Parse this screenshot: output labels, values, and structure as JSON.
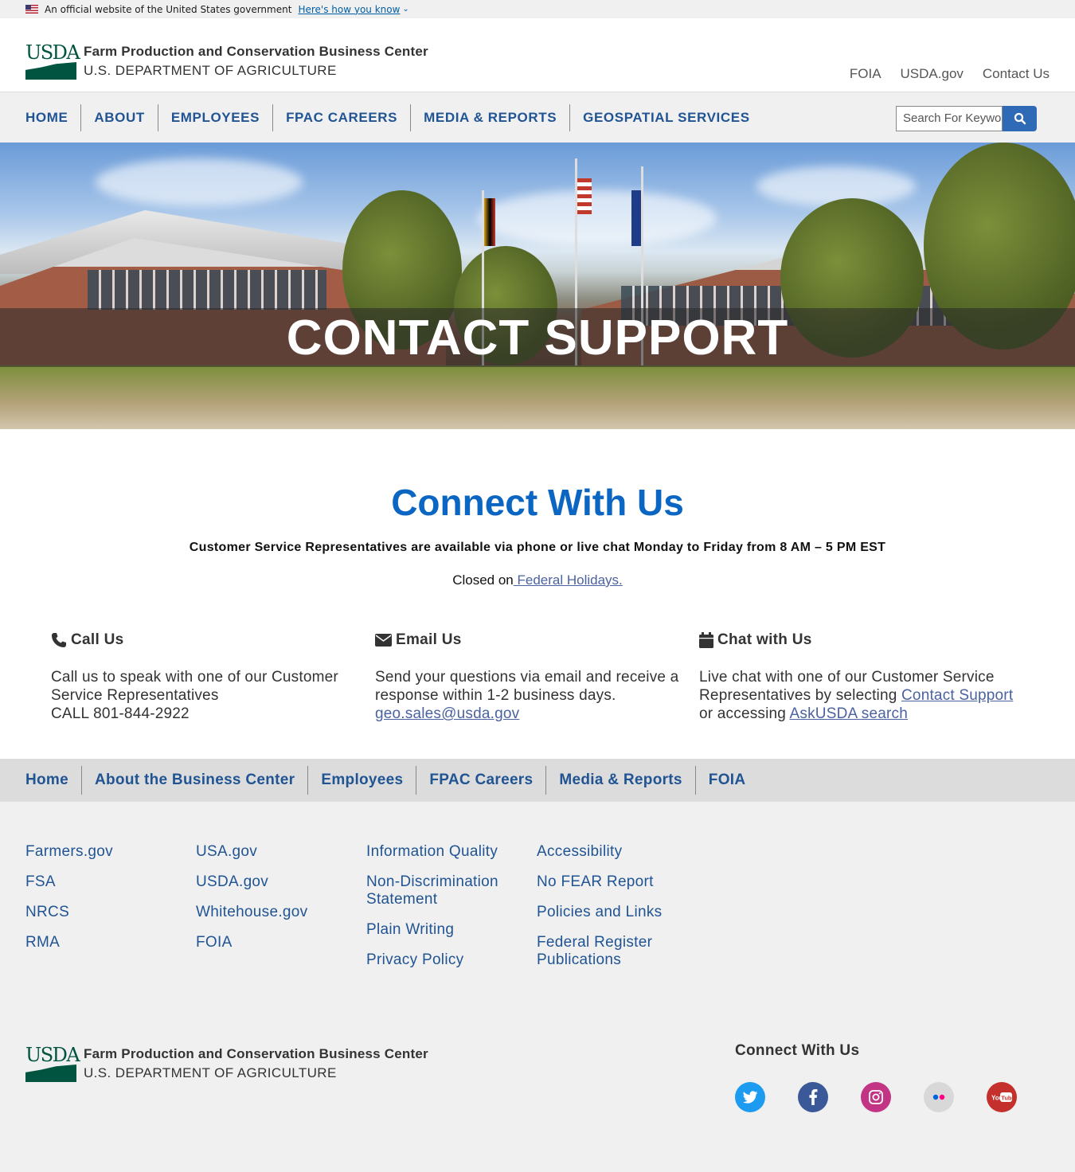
{
  "gov_banner": {
    "text": "An official website of the United States government",
    "link": "Here's how you know"
  },
  "header": {
    "logo_text": "USDA",
    "org_name": "Farm Production and Conservation Business Center",
    "dept_name": "U.S. DEPARTMENT OF AGRICULTURE",
    "utility_links": [
      "FOIA",
      "USDA.gov",
      "Contact Us"
    ]
  },
  "main_nav": {
    "items": [
      "HOME",
      "ABOUT",
      "EMPLOYEES",
      "FPAC CAREERS",
      "MEDIA & REPORTS",
      "GEOSPATIAL SERVICES"
    ],
    "search_placeholder": "Search For Keywords"
  },
  "hero": {
    "title": "CONTACT SUPPORT"
  },
  "connect": {
    "heading": "Connect With Us",
    "hours": "Customer Service Representatives are available via phone or live chat Monday to Friday from 8 AM – 5 PM EST",
    "closed_prefix": "Closed on",
    "closed_link": " Federal Holidays."
  },
  "contact_methods": {
    "call": {
      "title": "Call Us",
      "text": "Call us to speak with one of our Customer Service Representatives",
      "phone": "CALL 801-844-2922"
    },
    "email": {
      "title": "Email Us",
      "text": "Send your questions via email and receive a response within 1-2 business days.",
      "address": "geo.sales@usda.gov"
    },
    "chat": {
      "title": "Chat with Us",
      "text_before": "Live chat with one of our Customer Service Representatives by selecting",
      "link1": "Contact Support",
      "text_middle": "or accessing",
      "link2": "AskUSDA search"
    }
  },
  "footer_nav": {
    "items": [
      "Home",
      "About the Business Center",
      "Employees",
      "FPAC Careers",
      "Media & Reports",
      "FOIA"
    ]
  },
  "footer_links": {
    "col1": [
      "Farmers.gov",
      "FSA",
      "NRCS",
      "RMA"
    ],
    "col2": [
      "USA.gov",
      "USDA.gov",
      "Whitehouse.gov",
      "FOIA"
    ],
    "col3": [
      "Information Quality",
      "Non-Discrimination Statement",
      "Plain Writing",
      "Privacy Policy"
    ],
    "col4": [
      "Accessibility",
      "No FEAR Report",
      "Policies and Links",
      "Federal Register Publications"
    ]
  },
  "footer": {
    "logo_text": "USDA",
    "org_name": "Farm Production and Conservation Business Center",
    "dept_name": "U.S. DEPARTMENT OF AGRICULTURE",
    "social_title": "Connect With Us",
    "social": [
      {
        "name": "twitter-icon",
        "color": "#1d9bf0"
      },
      {
        "name": "facebook-icon",
        "color": "#3b5998"
      },
      {
        "name": "instagram-icon",
        "color": "#c13584"
      },
      {
        "name": "flickr-icon",
        "color": "#d8d8d8"
      },
      {
        "name": "youtube-icon",
        "color": "#c4302b"
      }
    ]
  }
}
